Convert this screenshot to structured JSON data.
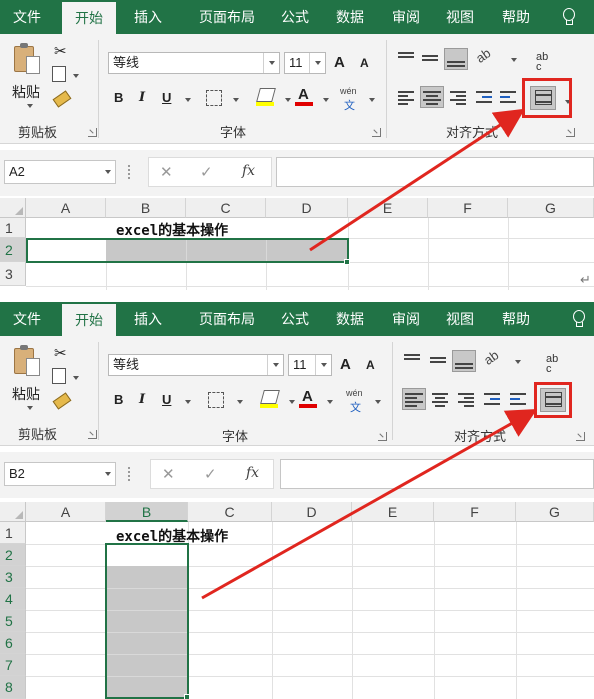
{
  "ribbon_tabs": [
    "文件",
    "开始",
    "插入",
    "页面布局",
    "公式",
    "数据",
    "审阅",
    "视图",
    "帮助"
  ],
  "clipboard": {
    "paste_label": "粘贴",
    "group_label": "剪贴板"
  },
  "font": {
    "name": "等线",
    "size": "11",
    "bold": "B",
    "italic": "I",
    "underline": "U",
    "grow": "A",
    "shrink": "A",
    "font_color_letter": "A",
    "phonetic_top": "wén",
    "phonetic_bottom": "文",
    "group_label": "字体"
  },
  "alignment": {
    "group_label": "对齐方式",
    "wrap_top": "ab",
    "wrap_bottom": "c"
  },
  "colors": {
    "ribbon_green": "#217346",
    "highlight_red": "#e0261f",
    "selection_gray": "#c8c8c8"
  },
  "formula_bar": {
    "cancel_symbol": "✕",
    "enter_symbol": "✓",
    "fx_label": "fx"
  },
  "panel_top": {
    "name_box": "A2",
    "columns": [
      "A",
      "B",
      "C",
      "D",
      "E",
      "F",
      "G"
    ],
    "rows": [
      "1",
      "2",
      "3"
    ],
    "title_cell": "excel的基本操作"
  },
  "panel_bottom": {
    "name_box": "B2",
    "columns": [
      "A",
      "B",
      "C",
      "D",
      "E",
      "F",
      "G"
    ],
    "rows": [
      "1",
      "2",
      "3",
      "4",
      "5",
      "6",
      "7",
      "8"
    ],
    "title_cell": "excel的基本操作"
  }
}
